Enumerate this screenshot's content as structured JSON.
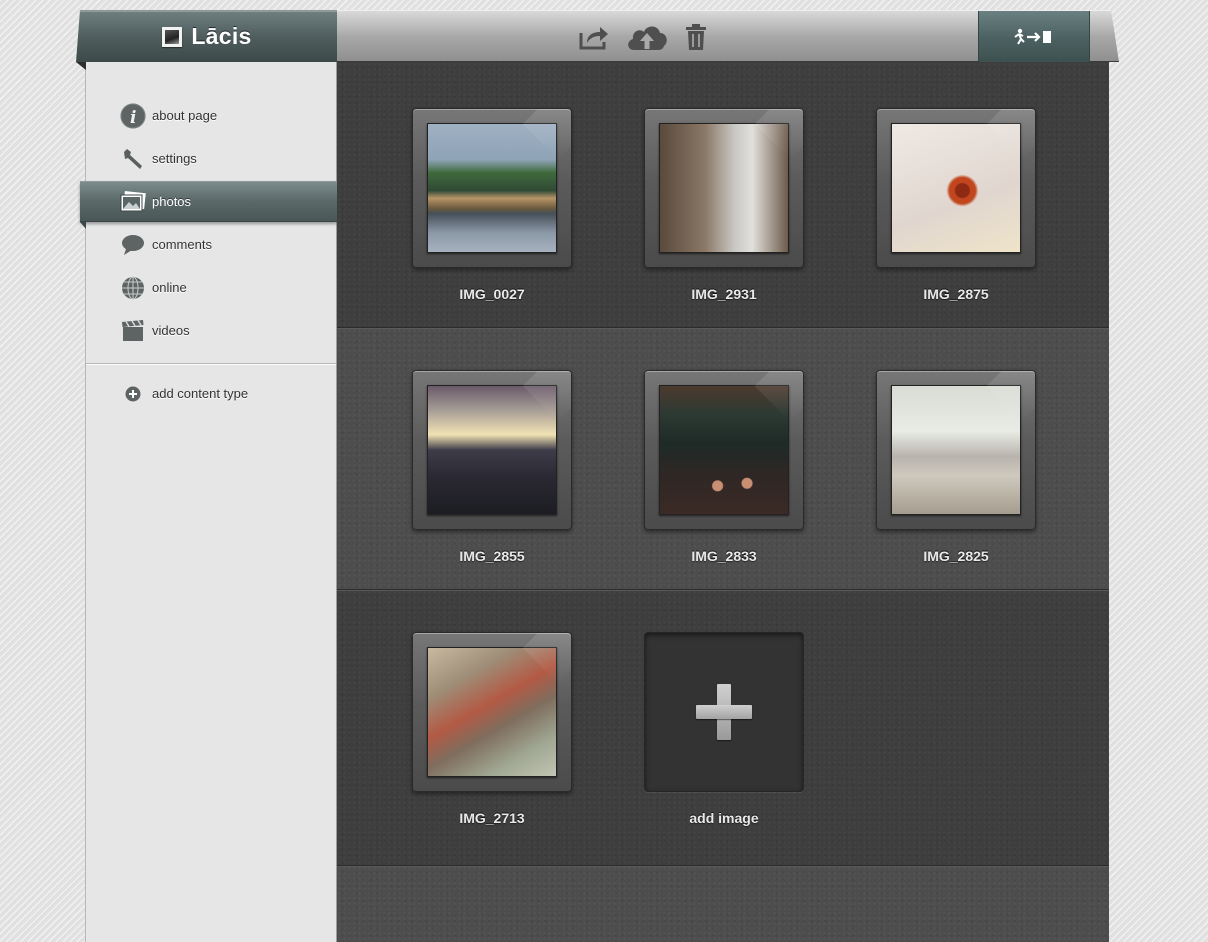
{
  "app": {
    "title": "Lācis"
  },
  "toolbar": {
    "share_icon": "share-icon",
    "upload_icon": "cloud-upload-icon",
    "trash_icon": "trash-icon",
    "logout_icon": "logout-icon"
  },
  "sidebar": {
    "items": [
      {
        "label": "about page",
        "icon": "info-icon"
      },
      {
        "label": "settings",
        "icon": "wrench-icon"
      },
      {
        "label": "photos",
        "icon": "photos-icon",
        "active": true
      },
      {
        "label": "comments",
        "icon": "speech-bubble-icon"
      },
      {
        "label": "online",
        "icon": "globe-icon"
      },
      {
        "label": "videos",
        "icon": "clapperboard-icon"
      }
    ],
    "add_content_type_label": "add content type"
  },
  "photos": [
    {
      "name": "IMG_0027"
    },
    {
      "name": "IMG_2931"
    },
    {
      "name": "IMG_2875"
    },
    {
      "name": "IMG_2855"
    },
    {
      "name": "IMG_2833"
    },
    {
      "name": "IMG_2825"
    },
    {
      "name": "IMG_2713"
    }
  ],
  "add_image_label": "add image",
  "colors": {
    "accent": "#4d5b5b",
    "sidebar_bg": "#e6e6e6",
    "content_dark": "#3e3e3e",
    "content_light": "#4d4d4d"
  }
}
